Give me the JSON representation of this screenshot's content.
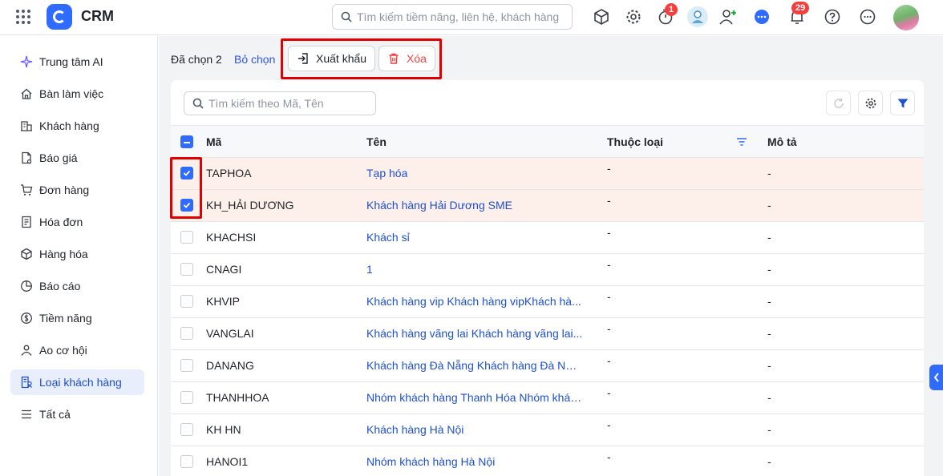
{
  "app": {
    "title": "CRM"
  },
  "header": {
    "search_placeholder": "Tìm kiếm tiềm năng, liên hệ, khách hàng",
    "timer_badge": "1",
    "notification_badge": "29"
  },
  "sidebar": {
    "items": [
      {
        "label": "Trung tâm AI",
        "icon": "sparkle-icon"
      },
      {
        "label": "Bàn làm việc",
        "icon": "home-icon"
      },
      {
        "label": "Khách hàng",
        "icon": "building-icon"
      },
      {
        "label": "Báo giá",
        "icon": "quote-doc-icon"
      },
      {
        "label": "Đơn hàng",
        "icon": "cart-icon"
      },
      {
        "label": "Hóa đơn",
        "icon": "invoice-icon"
      },
      {
        "label": "Hàng hóa",
        "icon": "box-icon"
      },
      {
        "label": "Báo cáo",
        "icon": "pie-chart-icon"
      },
      {
        "label": "Tiềm năng",
        "icon": "dollar-icon"
      },
      {
        "label": "Ao cơ hội",
        "icon": "people-icon"
      },
      {
        "label": "Loại khách hàng",
        "icon": "customer-type-icon",
        "active": true
      },
      {
        "label": "Tất cả",
        "icon": "menu-icon"
      }
    ]
  },
  "toolbar": {
    "selected_text": "Đã chọn 2",
    "deselect_label": "Bỏ chọn",
    "export_label": "Xuất khẩu",
    "delete_label": "Xóa"
  },
  "table": {
    "search_placeholder": "Tìm kiếm theo Mã, Tên",
    "headers": {
      "code": "Mã",
      "name": "Tên",
      "type": "Thuộc loại",
      "desc": "Mô tả"
    },
    "rows": [
      {
        "code": "TAPHOA",
        "name": "Tạp hóa",
        "type": "-",
        "desc": "-",
        "checked": true
      },
      {
        "code": "KH_HẢI DƯƠNG",
        "name": "Khách hàng Hải Dương SME",
        "type": "-",
        "desc": "-",
        "checked": true
      },
      {
        "code": "KHACHSI",
        "name": "Khách sỉ",
        "type": "-",
        "desc": "-",
        "checked": false
      },
      {
        "code": "CNAGI",
        "name": "1",
        "type": "-",
        "desc": "-",
        "checked": false
      },
      {
        "code": "KHVIP",
        "name": "Khách hàng vip Khách hàng vipKhách hà...",
        "type": "-",
        "desc": "-",
        "checked": false
      },
      {
        "code": "VANGLAI",
        "name": "Khách hàng vãng lai Khách hàng vãng lai...",
        "type": "-",
        "desc": "-",
        "checked": false
      },
      {
        "code": "DANANG",
        "name": "Khách hàng Đà Nẵng Khách hàng Đà Nẵn...",
        "type": "-",
        "desc": "-",
        "checked": false
      },
      {
        "code": "THANHHOA",
        "name": "Nhóm khách hàng Thanh Hóa Nhóm khác...",
        "type": "-",
        "desc": "-",
        "checked": false
      },
      {
        "code": "KH HN",
        "name": "Khách hàng Hà Nội",
        "type": "-",
        "desc": "-",
        "checked": false
      },
      {
        "code": "HANOI1",
        "name": "Nhóm khách hàng Hà Nội",
        "type": "-",
        "desc": "-",
        "checked": false
      }
    ]
  },
  "colors": {
    "accent": "#2f6bff",
    "danger": "#f53f3f",
    "selected_row": "#fdf0ea",
    "highlight_box": "#e00000"
  }
}
